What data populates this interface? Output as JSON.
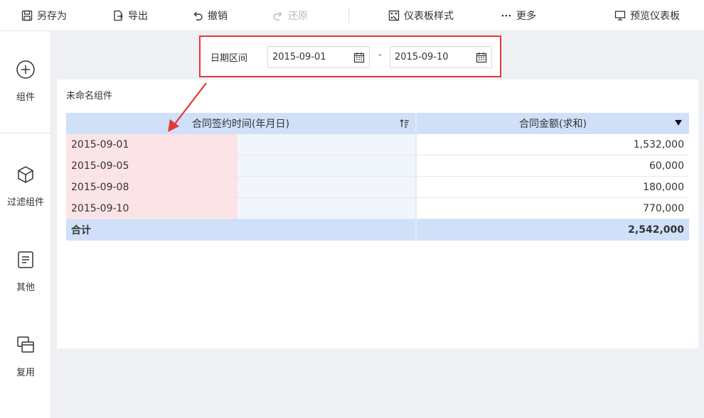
{
  "toolbar": {
    "save_as": "另存为",
    "export": "导出",
    "undo": "撤销",
    "redo": "还原",
    "style": "仪表板样式",
    "more": "更多",
    "preview": "预览仪表板"
  },
  "sidebar": {
    "items": [
      {
        "label": "组件",
        "icon": "plus-circle-icon"
      },
      {
        "label": "过滤组件",
        "icon": "cube-icon"
      },
      {
        "label": "其他",
        "icon": "document-icon"
      },
      {
        "label": "复用",
        "icon": "stacked-windows-icon"
      }
    ]
  },
  "filter": {
    "label": "日期区间",
    "start": "2015-09-01",
    "separator": "-",
    "end": "2015-09-10"
  },
  "widget": {
    "title": "未命名组件",
    "columns": [
      "合同签约时间(年月日)",
      "合同金额(求和)"
    ],
    "rows": [
      {
        "date": "2015-09-01",
        "amount": "1,532,000"
      },
      {
        "date": "2015-09-05",
        "amount": "60,000"
      },
      {
        "date": "2015-09-08",
        "amount": "180,000"
      },
      {
        "date": "2015-09-10",
        "amount": "770,000"
      }
    ],
    "total_label": "合计",
    "total_value": "2,542,000"
  },
  "colors": {
    "annotation": "#e53935",
    "header_bg": "#cfe0f8",
    "highlight": "#fce3e6"
  }
}
